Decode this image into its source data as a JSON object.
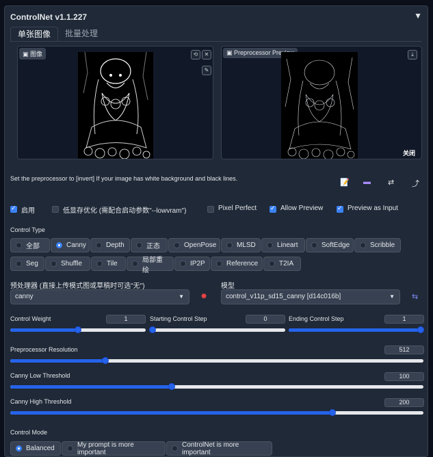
{
  "panel": {
    "title": "ControlNet v1.1.227",
    "collapse_icon": "▼",
    "tabs": [
      "单张图像",
      "批量处理"
    ]
  },
  "image_box": {
    "label": "图像"
  },
  "preview_box": {
    "label": "Preprocessor Preview",
    "close_label": "关闭"
  },
  "invert_hint": "Set the preprocessor to [invert] If your image has white background and black lines.",
  "checkboxes": [
    {
      "label": "启用",
      "checked": true
    },
    {
      "label": "低显存优化 (需配合启动参数\"--lowvram\")",
      "checked": false
    },
    {
      "label": "Pixel Perfect",
      "checked": false
    },
    {
      "label": "Allow Preview",
      "checked": true
    },
    {
      "label": "Preview as Input",
      "checked": true
    }
  ],
  "control_type": {
    "label": "Control Type",
    "selected": "Canny",
    "row1": [
      "全部",
      "Canny",
      "Depth",
      "正态",
      "OpenPose",
      "MLSD",
      "Lineart",
      "SoftEdge",
      "Scribble"
    ],
    "row2": [
      "Seg",
      "Shuffle",
      "Tile",
      "局部重绘",
      "IP2P",
      "Reference",
      "T2IA"
    ]
  },
  "preprocessor": {
    "label": "预处理器 (直接上传模式图或草稿时可选\"无\")",
    "value": "canny"
  },
  "model": {
    "label": "模型",
    "value": "control_v11p_sd15_canny [d14c016b]"
  },
  "control_weight": {
    "label": "Control Weight",
    "value": "1",
    "fraction": 0.5
  },
  "starting_step": {
    "label": "Starting Control Step",
    "value": "0",
    "fraction": 0.0
  },
  "ending_step": {
    "label": "Ending Control Step",
    "value": "1",
    "fraction": 1.0
  },
  "preprocessor_resolution": {
    "label": "Preprocessor Resolution",
    "value": "512",
    "fraction": 0.23
  },
  "canny_low": {
    "label": "Canny Low Threshold",
    "value": "100",
    "fraction": 0.39
  },
  "canny_high": {
    "label": "Canny High Threshold",
    "value": "200",
    "fraction": 0.78
  },
  "control_mode": {
    "label": "Control Mode",
    "options": [
      "Balanced",
      "My prompt is more important",
      "ControlNet is more important"
    ],
    "selected": "Balanced"
  },
  "colors": {
    "accent": "#3b82f6",
    "panel": "#1f2937",
    "background": "#0b0f19"
  }
}
